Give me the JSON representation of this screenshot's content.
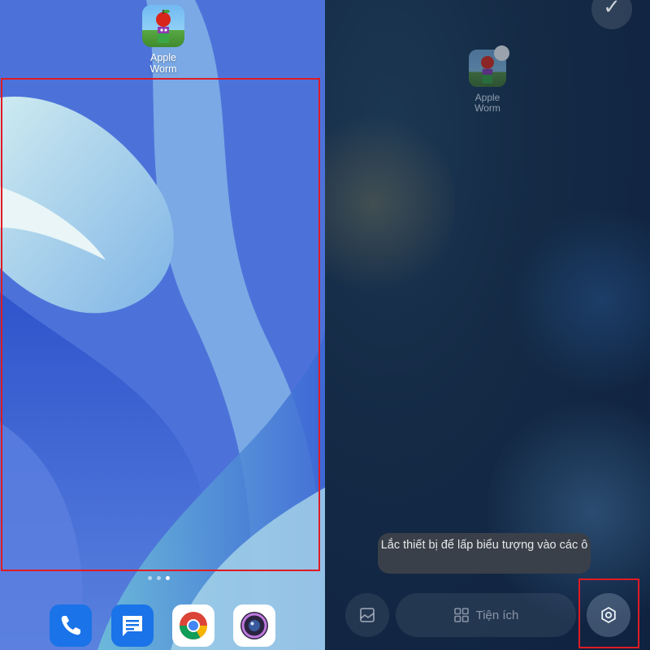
{
  "home_screen": {
    "app": {
      "name": "Apple Worm",
      "label_line1": "Apple",
      "label_line2": "Worm",
      "icon": "apple-worm-icon"
    },
    "dock": [
      {
        "name": "Phone",
        "icon": "phone-icon",
        "color": "#1a73e8"
      },
      {
        "name": "Messages",
        "icon": "messages-icon",
        "color": "#1a73e8"
      },
      {
        "name": "Chrome",
        "icon": "chrome-icon",
        "color": "#ffffff"
      },
      {
        "name": "Camera",
        "icon": "camera-icon",
        "color": "#ffffff"
      }
    ],
    "page_count": 3,
    "current_page": 3
  },
  "edit_mode": {
    "app": {
      "label_line1": "Apple",
      "label_line2": "Worm"
    },
    "toast_message": "Lắc thiết bị để lấp biểu tượng vào các ô",
    "bottom_bar": {
      "wallpaper_icon": "wallpaper-icon",
      "widgets_label": "Tiện ích",
      "widgets_icon": "widgets-icon",
      "settings_icon": "settings-icon"
    },
    "confirm_icon": "check-icon"
  },
  "colors": {
    "highlight": "#e01b24",
    "toast_bg": "#3a4049"
  }
}
